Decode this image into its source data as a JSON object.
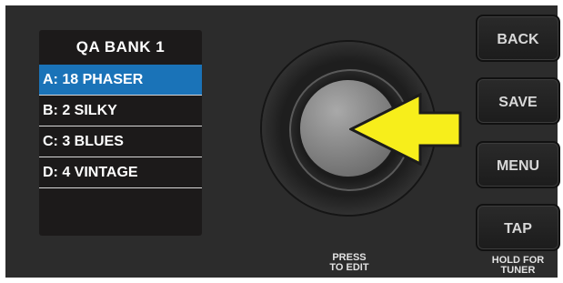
{
  "lcd": {
    "title": "QA BANK 1",
    "presets": [
      {
        "label": "A: 18 PHASER",
        "selected": true
      },
      {
        "label": "B: 2 SILKY",
        "selected": false
      },
      {
        "label": "C: 3 BLUES",
        "selected": false
      },
      {
        "label": "D: 4 VINTAGE",
        "selected": false
      }
    ],
    "selected_color": "#1a73b8"
  },
  "knob": {
    "label_line1": "PRESS",
    "label_line2": "TO EDIT"
  },
  "buttons": {
    "back": "BACK",
    "save": "SAVE",
    "menu": "MENU",
    "tap": "TAP",
    "tap_hold_line1": "HOLD FOR",
    "tap_hold_line2": "TUNER"
  },
  "arrow": {
    "icon": "yellow-arrow-pointing-left",
    "color": "#f7ee1b"
  }
}
